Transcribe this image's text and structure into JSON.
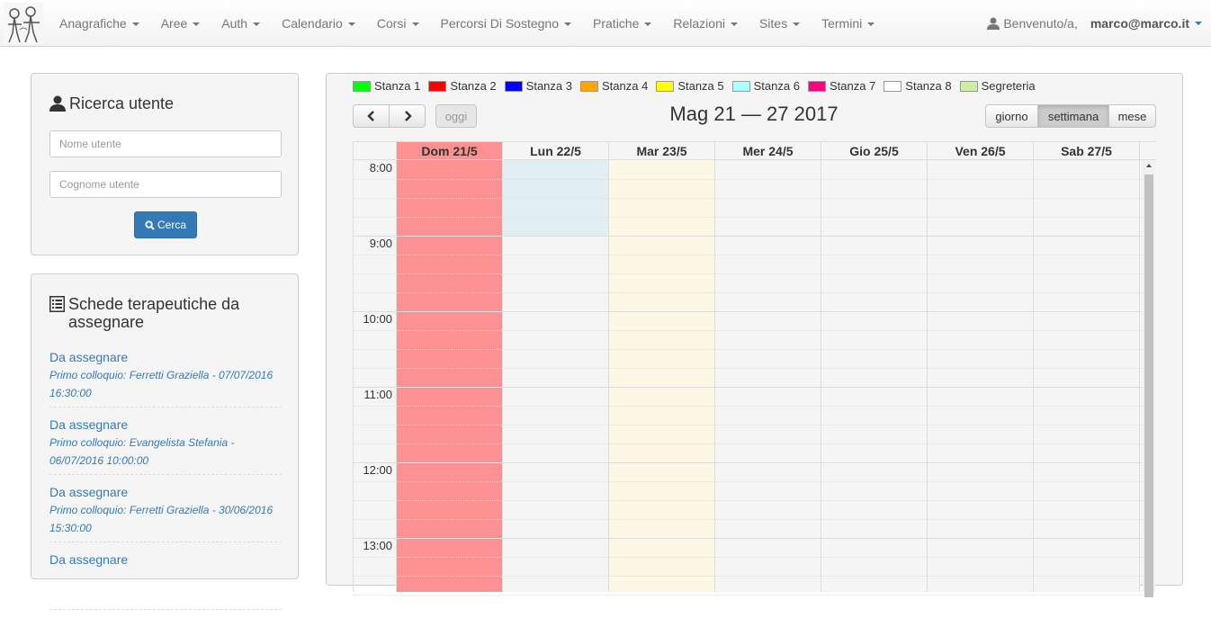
{
  "navbar": {
    "menu": [
      {
        "label": "Anagrafiche"
      },
      {
        "label": "Aree"
      },
      {
        "label": "Auth"
      },
      {
        "label": "Calendario"
      },
      {
        "label": "Corsi"
      },
      {
        "label": "Percorsi Di Sostegno"
      },
      {
        "label": "Pratiche"
      },
      {
        "label": "Relazioni"
      },
      {
        "label": "Sites"
      },
      {
        "label": "Termini"
      }
    ],
    "welcome": "Benvenuto/a,",
    "user_email": "marco@marco.it"
  },
  "search_panel": {
    "title": "Ricerca utente",
    "first_name_placeholder": "Nome utente",
    "last_name_placeholder": "Cognome utente",
    "search_button": "Cerca"
  },
  "schede_panel": {
    "title": "Schede terapeutiche da assegnare",
    "items": [
      {
        "link": "Da assegnare",
        "desc": "Primo colloquio: Ferretti Graziella - 07/07/2016 16:30:00"
      },
      {
        "link": "Da assegnare",
        "desc": "Primo colloquio: Evangelista Stefania - 06/07/2016 10:00:00"
      },
      {
        "link": "Da assegnare",
        "desc": "Primo colloquio: Ferretti Graziella - 30/06/2016 15:30:00"
      },
      {
        "link": "Da assegnare",
        "desc": ""
      }
    ]
  },
  "calendar": {
    "legend": [
      {
        "label": "Stanza 1",
        "color": "#00ff00"
      },
      {
        "label": "Stanza 2",
        "color": "#ff0000"
      },
      {
        "label": "Stanza 3",
        "color": "#0000ff"
      },
      {
        "label": "Stanza 4",
        "color": "#ffa500"
      },
      {
        "label": "Stanza 5",
        "color": "#ffff00"
      },
      {
        "label": "Stanza 6",
        "color": "#aaffff"
      },
      {
        "label": "Stanza 7",
        "color": "#ff0080"
      },
      {
        "label": "Stanza 8",
        "color": "#ffffff"
      },
      {
        "label": "Segreteria",
        "color": "#ccf0a0"
      }
    ],
    "title": "Mag 21 — 27 2017",
    "today_button": "oggi",
    "views": {
      "day": "giorno",
      "week": "settimana",
      "month": "mese"
    },
    "days": [
      {
        "label": "Dom 21/5",
        "today": true,
        "fill": "#fd9090"
      },
      {
        "label": "Lun 22/5",
        "fill": "#f5f5f5",
        "highlight": {
          "color": "#e1eef4",
          "from_slot": 0,
          "to_slot": 4
        }
      },
      {
        "label": "Mar 23/5",
        "fill": "#fcf8e3"
      },
      {
        "label": "Mer 24/5",
        "fill": "#f5f5f5"
      },
      {
        "label": "Gio 25/5",
        "fill": "#f5f5f5"
      },
      {
        "label": "Ven 26/5",
        "fill": "#f5f5f5"
      },
      {
        "label": "Sab 27/5",
        "fill": "#f5f5f5"
      }
    ],
    "hours": [
      "8:00",
      "9:00",
      "10:00",
      "11:00",
      "12:00",
      "13:00"
    ]
  }
}
